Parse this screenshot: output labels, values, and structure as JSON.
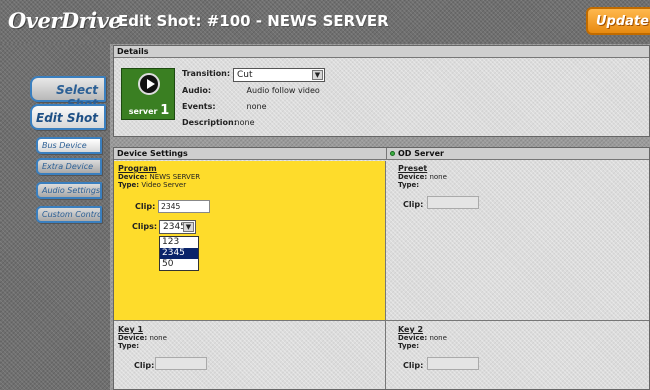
{
  "app": {
    "logo_text": "OverDrive",
    "title": "Edit Shot: #100 - NEWS SERVER",
    "update_button": "Update Sto"
  },
  "sidebar": {
    "nav": [
      {
        "label": "Select Shot"
      },
      {
        "label": "Edit Shot"
      }
    ],
    "sub": [
      {
        "label": "Bus Device"
      },
      {
        "label": "Extra Device"
      },
      {
        "label": "Audio Settings"
      },
      {
        "label": "Custom Control"
      }
    ]
  },
  "details": {
    "header": "Details",
    "server_tile": {
      "label_small": "server",
      "label_num": "1"
    },
    "transition_label": "Transition:",
    "transition_value": "Cut",
    "audio_label": "Audio:",
    "audio_value": "Audio follow video",
    "events_label": "Events:",
    "events_value": "none",
    "description_label": "Description:",
    "description_value": "none"
  },
  "device_settings": {
    "header": "Device Settings",
    "server_header": "OD Server",
    "program": {
      "title": "Program",
      "device_label": "Device:",
      "device_value": "NEWS SERVER",
      "type_label": "Type:",
      "type_value": "Video Server",
      "clip_label": "Clip:",
      "clip_value": "2345",
      "clips_label": "Clips:",
      "clips_selected": "2345",
      "clips_options": [
        "123",
        "2345",
        "50"
      ]
    },
    "preset": {
      "title": "Preset",
      "device_label": "Device:",
      "device_value": "none",
      "type_label": "Type:",
      "type_value": "",
      "clip_label": "Clip:",
      "clip_value": ""
    },
    "key1": {
      "title": "Key 1",
      "device_label": "Device:",
      "device_value": "none",
      "type_label": "Type:",
      "type_value": "",
      "clip_label": "Clip:",
      "clip_value": ""
    },
    "key2": {
      "title": "Key 2",
      "device_label": "Device:",
      "device_value": "none",
      "type_label": "Type:",
      "type_value": "",
      "clip_label": "Clip:",
      "clip_value": ""
    }
  },
  "colors": {
    "program_bg": "#fedc2b",
    "accent_blue": "#3a7fbf",
    "update_orange": "#f59a1f",
    "server_green": "#3a7f22"
  },
  "icons": {
    "play": "play-icon",
    "status": "status-dot-icon",
    "dropdown": "chevron-down-icon"
  }
}
